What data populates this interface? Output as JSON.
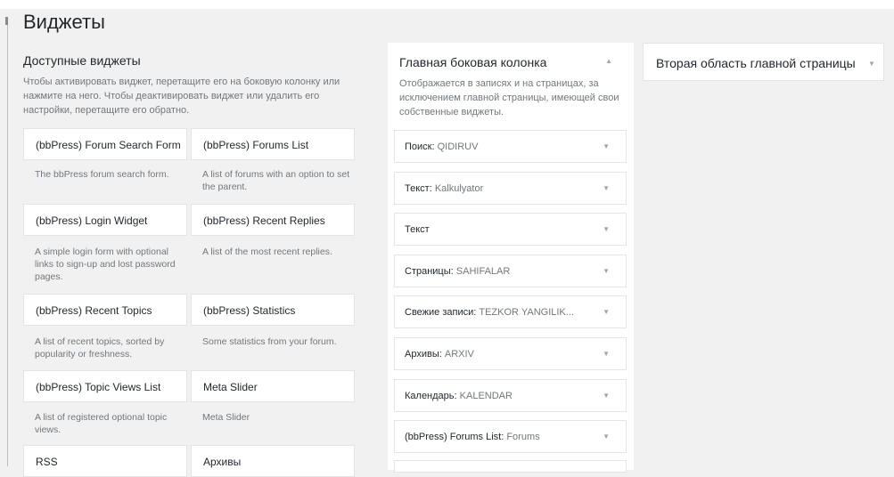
{
  "page": {
    "title": "Виджеты"
  },
  "available": {
    "title": "Доступные виджеты",
    "description": "Чтобы активировать виджет, перетащите его на боковую колонку или нажмите на него. Чтобы деактивировать виджет или удалить его настройки, перетащите его обратно.",
    "widgets": [
      {
        "label": "(bbPress) Forum Search Form",
        "desc": "The bbPress forum search form."
      },
      {
        "label": "(bbPress) Forums List",
        "desc": "A list of forums with an option to set the parent."
      },
      {
        "label": "(bbPress) Login Widget",
        "desc": "A simple login form with optional links to sign-up and lost password pages."
      },
      {
        "label": "(bbPress) Recent Replies",
        "desc": "A list of the most recent replies."
      },
      {
        "label": "(bbPress) Recent Topics",
        "desc": "A list of recent topics, sorted by popularity or freshness."
      },
      {
        "label": "(bbPress) Statistics",
        "desc": "Some statistics from your forum."
      },
      {
        "label": "(bbPress) Topic Views List",
        "desc": "A list of registered optional topic views."
      },
      {
        "label": "Meta Slider",
        "desc": "Meta Slider"
      },
      {
        "label": "RSS",
        "desc": ""
      },
      {
        "label": "Архивы",
        "desc": ""
      }
    ]
  },
  "main_sidebar": {
    "title": "Главная боковая колонка",
    "description": "Отображается в записях и на страницах, за исключением главной страницы, имеющей свои собственные виджеты.",
    "widgets": [
      {
        "type": "Поиск",
        "title": "QIDIRUV"
      },
      {
        "type": "Текст",
        "title": "Kalkulyator"
      },
      {
        "type": "Текст",
        "title": ""
      },
      {
        "type": "Страницы",
        "title": "SAHIFALAR"
      },
      {
        "type": "Свежие записи",
        "title": "TEZKOR YANGILIK..."
      },
      {
        "type": "Архивы",
        "title": "ARXIV"
      },
      {
        "type": "Календарь",
        "title": "KALENDAR"
      },
      {
        "type": "(bbPress) Forums List",
        "title": "Forums"
      }
    ]
  },
  "second_sidebar": {
    "title": "Вторая область главной страницы"
  },
  "icons": {
    "expand": "triangle-down-icon",
    "collapse": "triangle-up-icon"
  }
}
